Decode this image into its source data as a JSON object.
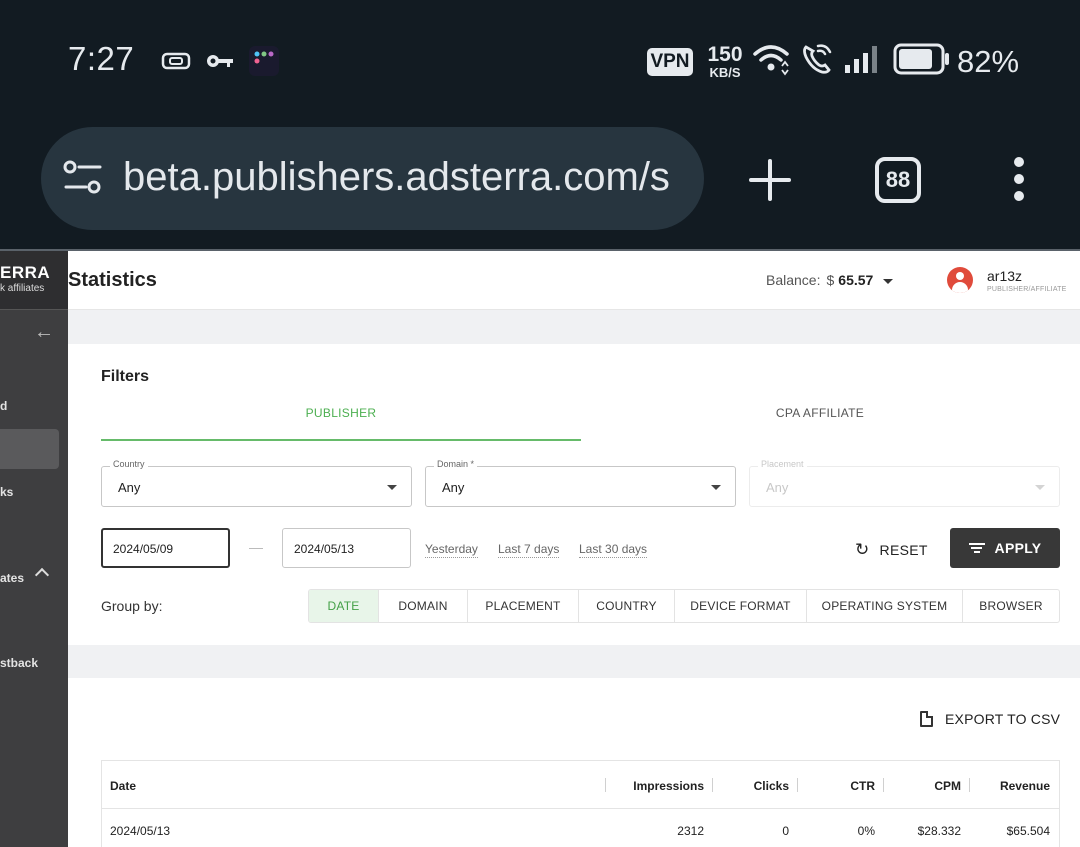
{
  "status_bar": {
    "time": "7:27",
    "vpn": "VPN",
    "speed_value": "150",
    "speed_unit": "KB/S",
    "battery_percent": "82%",
    "battery_level": 0.82,
    "icons": [
      "cast-icon",
      "key-icon",
      "app-icon",
      "wifi-icon",
      "wifi-call-icon",
      "signal-icon",
      "battery-icon"
    ]
  },
  "browser": {
    "url": "beta.publishers.adsterra.com/s",
    "tab_count": "88",
    "icons": [
      "site-settings-icon",
      "new-tab-icon",
      "tabs-icon",
      "more-menu-icon"
    ]
  },
  "sidebar": {
    "brand_line1": "ERRA",
    "brand_line2": "k affiliates",
    "items": [
      {
        "label": "d"
      },
      {
        "label": "ks"
      },
      {
        "label": "ates"
      },
      {
        "label": "stback"
      }
    ]
  },
  "header": {
    "title": "Statistics",
    "balance_label": "Balance:",
    "currency": "$",
    "balance_value": "65.57",
    "user_name": "ar13z",
    "user_role": "PUBLISHER/AFFILIATE"
  },
  "filters": {
    "title": "Filters",
    "tabs": [
      {
        "label": "PUBLISHER",
        "active": true
      },
      {
        "label": "CPA AFFILIATE",
        "active": false
      }
    ],
    "country": {
      "label": "Country",
      "value": "Any"
    },
    "domain": {
      "label": "Domain *",
      "value": "Any"
    },
    "placement": {
      "label": "Placement",
      "value": "Any",
      "disabled": true
    },
    "date_from": "2024/05/09",
    "date_to": "2024/05/13",
    "quick_ranges": [
      "Yesterday",
      "Last 7 days",
      "Last 30 days"
    ],
    "reset_label": "RESET",
    "apply_label": "APPLY",
    "group_by_label": "Group by:",
    "group_by": [
      {
        "label": "DATE",
        "active": true
      },
      {
        "label": "DOMAIN",
        "active": false
      },
      {
        "label": "PLACEMENT",
        "active": false
      },
      {
        "label": "COUNTRY",
        "active": false
      },
      {
        "label": "DEVICE FORMAT",
        "active": false
      },
      {
        "label": "OPERATING SYSTEM",
        "active": false
      },
      {
        "label": "BROWSER",
        "active": false
      }
    ]
  },
  "table": {
    "export_label": "EXPORT TO CSV",
    "columns": [
      "Date",
      "Impressions",
      "Clicks",
      "CTR",
      "CPM",
      "Revenue"
    ],
    "rows": [
      [
        "2024/05/13",
        "2312",
        "0",
        "0%",
        "$28.332",
        "$65.504"
      ]
    ]
  },
  "colors": {
    "accent_green": "#4caf50",
    "apply_bg": "#383838",
    "sidebar_bg": "#3e3e40",
    "phone_bar": "#121b22",
    "avatar": "#e04b3b"
  }
}
